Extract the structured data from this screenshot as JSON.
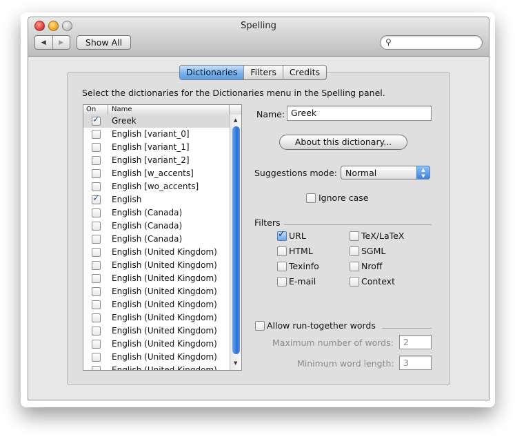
{
  "window": {
    "title": "Spelling"
  },
  "toolbar": {
    "back_glyph": "◀",
    "forward_glyph": "▶",
    "show_all_label": "Show All",
    "search_icon": "search-icon"
  },
  "tabs": [
    {
      "label": "Dictionaries",
      "active": true
    },
    {
      "label": "Filters",
      "active": false
    },
    {
      "label": "Credits",
      "active": false
    }
  ],
  "instructions": "Select the dictionaries for the Dictionaries menu in the Spelling panel.",
  "dictionary_list": {
    "columns": [
      "On",
      "Name"
    ],
    "rows": [
      {
        "checked": true,
        "name": "Greek",
        "selected": true
      },
      {
        "checked": false,
        "name": "English [variant_0]"
      },
      {
        "checked": false,
        "name": "English [variant_1]"
      },
      {
        "checked": false,
        "name": "English [variant_2]"
      },
      {
        "checked": false,
        "name": "English [w_accents]"
      },
      {
        "checked": false,
        "name": "English [wo_accents]"
      },
      {
        "checked": true,
        "name": "English"
      },
      {
        "checked": false,
        "name": "English (Canada)"
      },
      {
        "checked": false,
        "name": "English (Canada)"
      },
      {
        "checked": false,
        "name": "English (Canada)"
      },
      {
        "checked": false,
        "name": "English (United Kingdom)"
      },
      {
        "checked": false,
        "name": "English (United Kingdom)"
      },
      {
        "checked": false,
        "name": "English (United Kingdom)"
      },
      {
        "checked": false,
        "name": "English (United Kingdom)"
      },
      {
        "checked": false,
        "name": "English (United Kingdom)"
      },
      {
        "checked": false,
        "name": "English (United Kingdom)"
      },
      {
        "checked": false,
        "name": "English (United Kingdom)"
      },
      {
        "checked": false,
        "name": "English (United Kingdom)"
      },
      {
        "checked": false,
        "name": "English (United Kingdom)"
      },
      {
        "checked": false,
        "name": "English (United Kingdom)"
      }
    ]
  },
  "details": {
    "name_label": "Name:",
    "name_value": "Greek",
    "about_button": "About this dictionary...",
    "suggestions_label": "Suggestions mode:",
    "suggestions_value": "Normal",
    "ignore_case_label": "Ignore case",
    "ignore_case_checked": false,
    "filters_heading": "Filters",
    "filters": {
      "url": {
        "label": "URL",
        "checked": true
      },
      "tex": {
        "label": "TeX/LaTeX",
        "checked": false
      },
      "html": {
        "label": "HTML",
        "checked": false
      },
      "sgml": {
        "label": "SGML",
        "checked": false
      },
      "texinfo": {
        "label": "Texinfo",
        "checked": false
      },
      "nroff": {
        "label": "Nroff",
        "checked": false
      },
      "email": {
        "label": "E-mail",
        "checked": false
      },
      "context": {
        "label": "Context",
        "checked": false
      }
    },
    "run_together_label": "Allow run-together words",
    "run_together_checked": false,
    "max_words_label": "Maximum number of words:",
    "max_words_value": "2",
    "min_length_label": "Minimum word length:",
    "min_length_value": "3"
  }
}
